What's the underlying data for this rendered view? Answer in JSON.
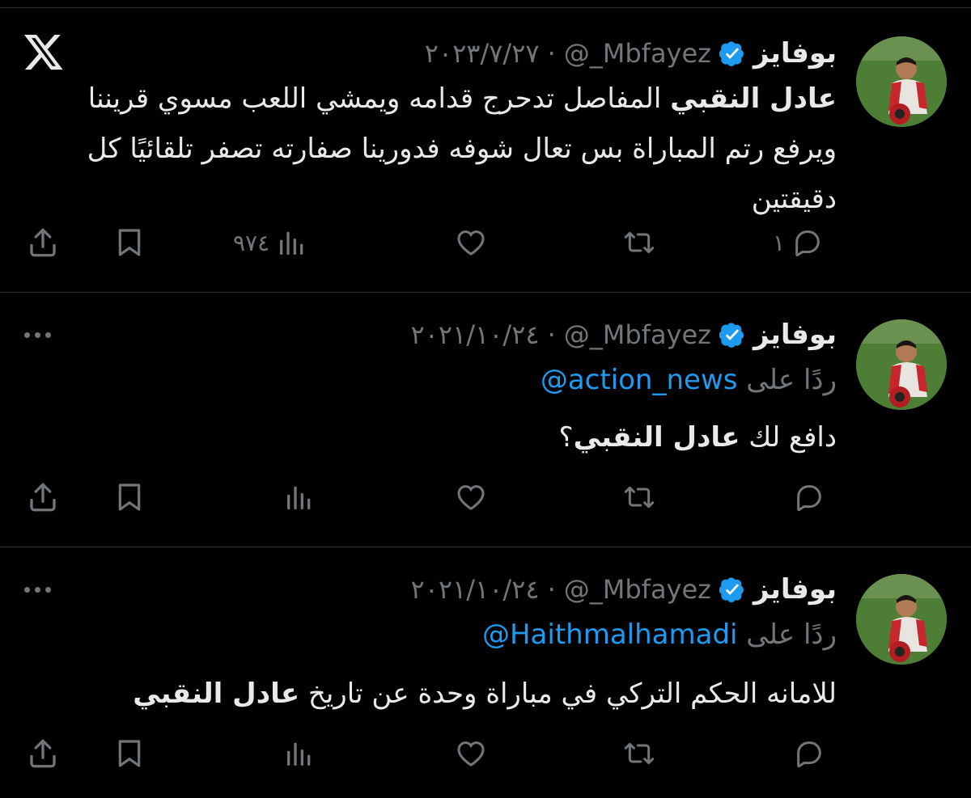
{
  "icons": {
    "logo": "x-logo-icon",
    "verified": "verified-badge-icon",
    "reply": "reply-icon",
    "retweet": "retweet-icon",
    "like": "heart-icon",
    "views": "views-icon",
    "bookmark": "bookmark-icon",
    "share": "share-icon",
    "more": "more-icon"
  },
  "colors": {
    "background": "#000000",
    "text": "#e7e9ea",
    "muted": "#71767b",
    "accent": "#1d9bf0",
    "divider": "#2f3336"
  },
  "tweets": [
    {
      "name": "بوفايز",
      "handle": "@_Mbfayez",
      "separator": "·",
      "date": "٢٠٢٣/٧/٢٧",
      "bold": "عادل النقبي",
      "text_rest": " المفاصل تدحرج قدامه ويمشي اللعب مسوي قريننا ويرفع رتم المباراة بس تعال شوفه فدورينا صفارته تصفر تلقائيًا كل دقيقتين",
      "replies": "١",
      "views": "٩٧٤"
    },
    {
      "name": "بوفايز",
      "handle": "@_Mbfayez",
      "separator": "·",
      "date": "٢٠٢١/١٠/٢٤",
      "reply_to_label": "ردًا على",
      "reply_to": "@action_news",
      "text_before": "دافع لك ",
      "bold": "عادل النقبي",
      "text_after": "؟"
    },
    {
      "name": "بوفايز",
      "handle": "@_Mbfayez",
      "separator": "·",
      "date": "٢٠٢١/١٠/٢٤",
      "reply_to_label": "ردًا على",
      "reply_to": "@Haithmalhamadi",
      "text_before": "للامانه الحكم التركي في مباراة وحدة عن تاريخ ",
      "bold": "عادل النقبي"
    }
  ]
}
